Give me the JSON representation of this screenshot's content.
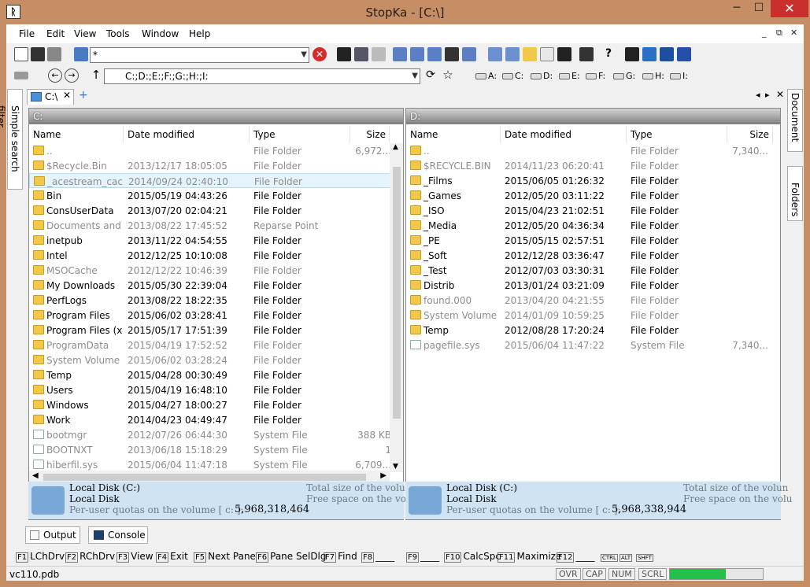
{
  "window": {
    "title": "StopKa - [C:\\]",
    "min": "─",
    "max": "☐",
    "close": "✕"
  },
  "menu": [
    {
      "label": "File"
    },
    {
      "label": "Edit"
    },
    {
      "label": "View"
    },
    {
      "label": "Tools"
    },
    {
      "label": "Window"
    },
    {
      "label": "Help"
    }
  ],
  "mdi": {
    "min": "_",
    "restore": "⧉",
    "close": "✕"
  },
  "toolbar1": {
    "filter_value": "*"
  },
  "toolbar2": {
    "path_value": "C:;D:;E:;F:;G:;H:;I:"
  },
  "drives": [
    "A:",
    "C:",
    "D:",
    "E:",
    "F:",
    "G:",
    "H:",
    "I:"
  ],
  "side_tabs": {
    "left": "Simple search filter",
    "right_top": "Document",
    "right_bottom": "Folders"
  },
  "tabs": {
    "active": "C:\\",
    "add": "+"
  },
  "left_pane": {
    "header": "C:",
    "columns": [
      "Name",
      "Date modified",
      "Type",
      "Size"
    ],
    "rows": [
      {
        "name": "..",
        "date": "",
        "type": "File Folder",
        "size": "6,972...",
        "dim": true
      },
      {
        "name": "$Recycle.Bin",
        "date": "2013/12/17 18:05:05",
        "type": "File Folder",
        "size": "",
        "dim": true
      },
      {
        "name": "_acestream_cac...",
        "date": "2014/09/24 02:40:10",
        "type": "File Folder",
        "size": "",
        "dim": true
      },
      {
        "name": "Bin",
        "date": "2015/05/19 04:43:26",
        "type": "File Folder",
        "size": "",
        "dim": false
      },
      {
        "name": "ConsUserData",
        "date": "2013/07/20 02:04:21",
        "type": "File Folder",
        "size": "",
        "dim": false
      },
      {
        "name": "Documents and...",
        "date": "2013/08/22 17:45:52",
        "type": "Reparse Point",
        "size": "",
        "dim": true
      },
      {
        "name": "inetpub",
        "date": "2013/11/22 04:54:55",
        "type": "File Folder",
        "size": "",
        "dim": false
      },
      {
        "name": "Intel",
        "date": "2012/12/25 10:10:08",
        "type": "File Folder",
        "size": "",
        "dim": false
      },
      {
        "name": "MSOCache",
        "date": "2012/12/22 10:46:39",
        "type": "File Folder",
        "size": "",
        "dim": true
      },
      {
        "name": "My Downloads",
        "date": "2015/05/30 22:39:04",
        "type": "File Folder",
        "size": "",
        "dim": false
      },
      {
        "name": "PerfLogs",
        "date": "2013/08/22 18:22:35",
        "type": "File Folder",
        "size": "",
        "dim": false
      },
      {
        "name": "Program Files",
        "date": "2015/06/02 03:28:41",
        "type": "File Folder",
        "size": "",
        "dim": false
      },
      {
        "name": "Program Files (x...",
        "date": "2015/05/17 17:51:39",
        "type": "File Folder",
        "size": "",
        "dim": false
      },
      {
        "name": "ProgramData",
        "date": "2015/04/19 17:52:52",
        "type": "File Folder",
        "size": "",
        "dim": true
      },
      {
        "name": "System Volume ...",
        "date": "2015/06/02 03:28:24",
        "type": "File Folder",
        "size": "",
        "dim": true
      },
      {
        "name": "Temp",
        "date": "2015/04/28 00:30:49",
        "type": "File Folder",
        "size": "",
        "dim": false
      },
      {
        "name": "Users",
        "date": "2015/04/19 16:48:10",
        "type": "File Folder",
        "size": "",
        "dim": false
      },
      {
        "name": "Windows",
        "date": "2015/04/27 18:00:27",
        "type": "File Folder",
        "size": "",
        "dim": false
      },
      {
        "name": "Work",
        "date": "2014/04/23 04:49:47",
        "type": "File Folder",
        "size": "",
        "dim": false
      },
      {
        "name": "bootmgr",
        "date": "2012/07/26 06:44:30",
        "type": "System File",
        "size": "388 KB",
        "dim": true
      },
      {
        "name": "BOOTNXT",
        "date": "2013/06/18 15:18:29",
        "type": "System File",
        "size": "1",
        "dim": true
      },
      {
        "name": "hiberfil.sys",
        "date": "2015/06/04 11:47:18",
        "type": "System File",
        "size": "6,709...",
        "dim": true
      }
    ],
    "info": {
      "label1": "Local Disk (C:)",
      "label2": "Local Disk",
      "quota": "Per-user quotas on the volume [ c: ]:",
      "quota_value": "5,968,318,464",
      "total": "Total size of the volum",
      "free": "Free space on the volu"
    }
  },
  "right_pane": {
    "header": "D:",
    "columns": [
      "Name",
      "Date modified",
      "Type",
      "Size"
    ],
    "rows": [
      {
        "name": "..",
        "date": "",
        "type": "File Folder",
        "size": "7,340...",
        "dim": true
      },
      {
        "name": "$RECYCLE.BIN",
        "date": "2014/11/23 06:20:41",
        "type": "File Folder",
        "size": "",
        "dim": true
      },
      {
        "name": "_Films",
        "date": "2015/06/05 01:26:32",
        "type": "File Folder",
        "size": "",
        "dim": false
      },
      {
        "name": "_Games",
        "date": "2012/05/20 03:11:22",
        "type": "File Folder",
        "size": "",
        "dim": false
      },
      {
        "name": "_ISO",
        "date": "2015/04/23 21:02:51",
        "type": "File Folder",
        "size": "",
        "dim": false
      },
      {
        "name": "_Media",
        "date": "2012/05/20 04:36:34",
        "type": "File Folder",
        "size": "",
        "dim": false
      },
      {
        "name": "_PE",
        "date": "2015/05/15 02:57:51",
        "type": "File Folder",
        "size": "",
        "dim": false
      },
      {
        "name": "_Soft",
        "date": "2012/12/28 03:36:47",
        "type": "File Folder",
        "size": "",
        "dim": false
      },
      {
        "name": "_Test",
        "date": "2012/07/03 03:30:31",
        "type": "File Folder",
        "size": "",
        "dim": false
      },
      {
        "name": "Distrib",
        "date": "2013/01/24 03:21:09",
        "type": "File Folder",
        "size": "",
        "dim": false
      },
      {
        "name": "found.000",
        "date": "2013/04/20 04:21:55",
        "type": "File Folder",
        "size": "",
        "dim": true
      },
      {
        "name": "System Volume ...",
        "date": "2014/01/09 10:59:25",
        "type": "File Folder",
        "size": "",
        "dim": true
      },
      {
        "name": "Temp",
        "date": "2012/08/28 17:20:24",
        "type": "File Folder",
        "size": "",
        "dim": false
      },
      {
        "name": "pagefile.sys",
        "date": "2015/06/04 11:47:22",
        "type": "System File",
        "size": "7,340...",
        "dim": true
      }
    ],
    "info": {
      "label1": "Local Disk (C:)",
      "label2": "Local Disk",
      "quota": "Per-user quotas on the volume [ c: ]:",
      "quota_value": "5,968,338,944",
      "total": "Total size of the volun",
      "free": "Free space on the volu"
    }
  },
  "bottom_tabs": {
    "output": "Output",
    "console": "Console"
  },
  "fkeys": [
    {
      "key": "F1",
      "label": "LChDrv"
    },
    {
      "key": "F2",
      "label": "RChDrv"
    },
    {
      "key": "F3",
      "label": "View"
    },
    {
      "key": "F4",
      "label": "Exit"
    },
    {
      "key": "F5",
      "label": "Next Pane"
    },
    {
      "key": "F6",
      "label": "Pane SelDlg"
    },
    {
      "key": "F7",
      "label": "Find"
    },
    {
      "key": "F8",
      "label": "____"
    },
    {
      "key": "F9",
      "label": "____"
    },
    {
      "key": "F10",
      "label": "CalcSpc"
    },
    {
      "key": "F11",
      "label": "Maximize"
    },
    {
      "key": "F12",
      "label": "____"
    },
    {
      "key": "CTRL",
      "label": ""
    },
    {
      "key": "ALT",
      "label": ""
    },
    {
      "key": "SHFT",
      "label": ""
    }
  ],
  "status": {
    "text": "vc110.pdb",
    "ovr": "OVR",
    "cap": "CAP",
    "num": "NUM",
    "scrl": "SCRL",
    "progress": 0.6
  },
  "colors": {
    "frame": "#c68e64",
    "close": "#c9302c",
    "folder": "#f2c84b",
    "info_bg": "#cfe3f2",
    "progress": "#22c14a"
  }
}
